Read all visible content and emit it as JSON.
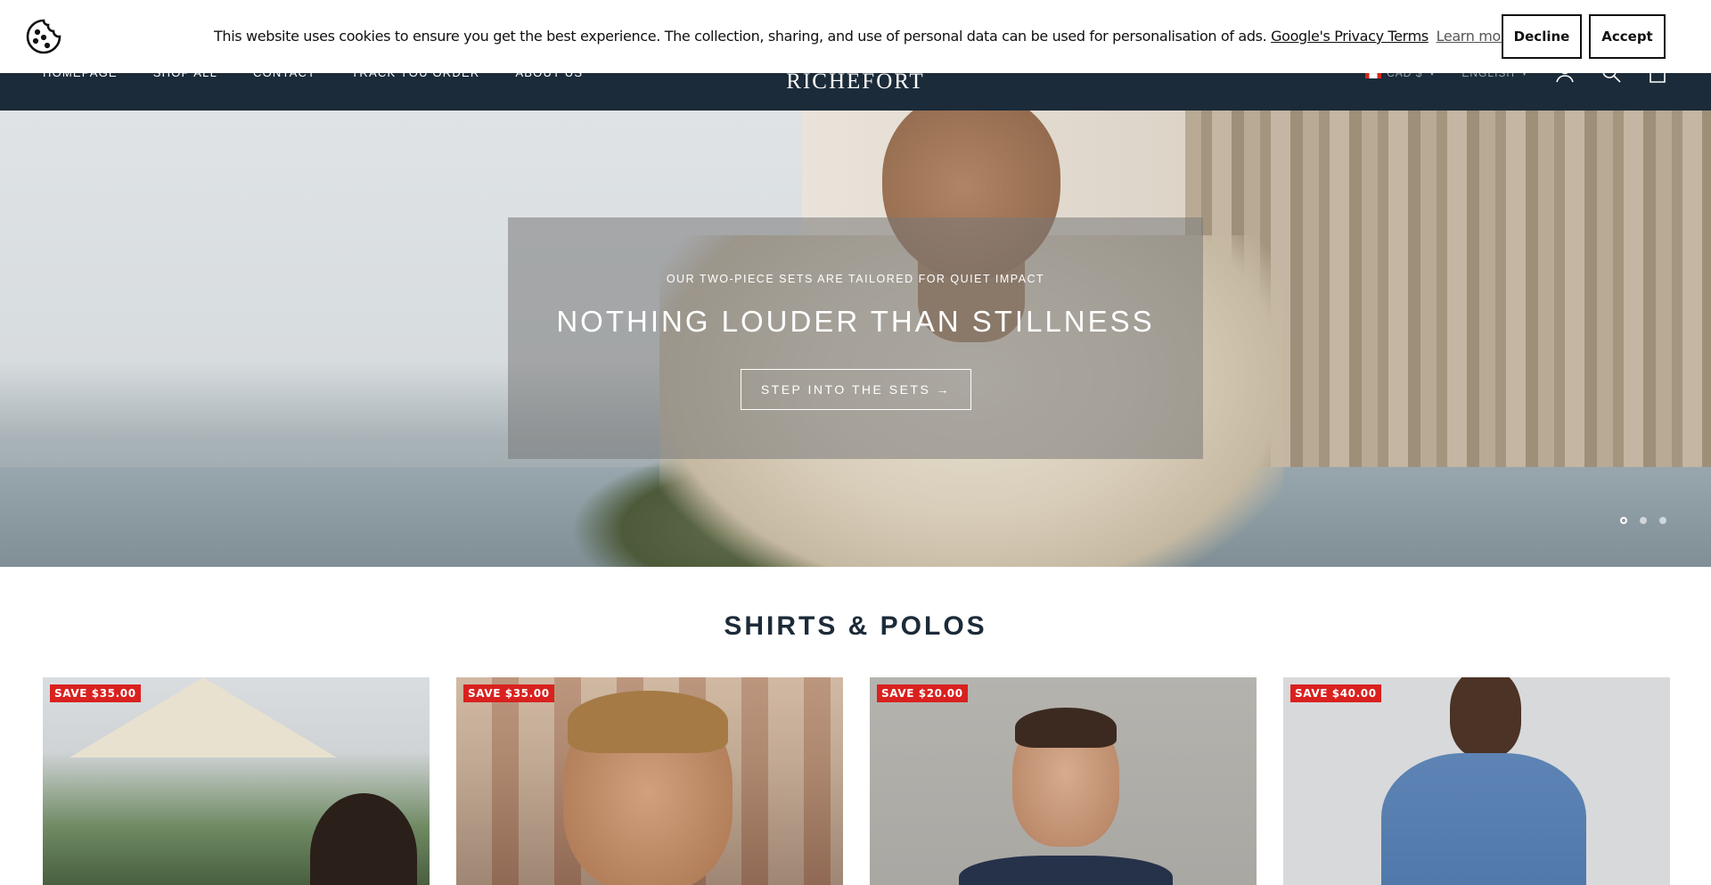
{
  "cookie": {
    "message": "This website uses cookies to ensure you get the best experience. The collection, sharing, and use of personal data can be used for personalisation of ads.",
    "privacy_link": "Google's Privacy Terms",
    "learn_more": "Learn more",
    "decline_label": "Decline",
    "accept_label": "Accept"
  },
  "header": {
    "nav": [
      "HOMEPAGE",
      "SHOP ALL",
      "CONTACT",
      "TRACK YOU ORDER",
      "ABOUT US"
    ],
    "logo": "RICHEFORT",
    "currency": "CAD $",
    "language": "ENGLISH",
    "icons": [
      "account-icon",
      "search-icon",
      "cart-icon"
    ]
  },
  "hero": {
    "subtitle": "OUR TWO-PIECE SETS ARE TAILORED FOR QUIET IMPACT",
    "title": "NOTHING LOUDER THAN STILLNESS",
    "button_label": "STEP INTO THE SETS →",
    "slides": 3,
    "active_slide": 1
  },
  "collection": {
    "title": "SHIRTS & POLOS",
    "products": [
      {
        "badge": "SAVE $35.00"
      },
      {
        "badge": "SAVE $35.00"
      },
      {
        "badge": "SAVE $20.00"
      },
      {
        "badge": "SAVE $40.00"
      }
    ]
  },
  "colors": {
    "header_bg": "#1c2b39",
    "badge_red": "#d9211f",
    "text_dark": "#1c2b39"
  }
}
